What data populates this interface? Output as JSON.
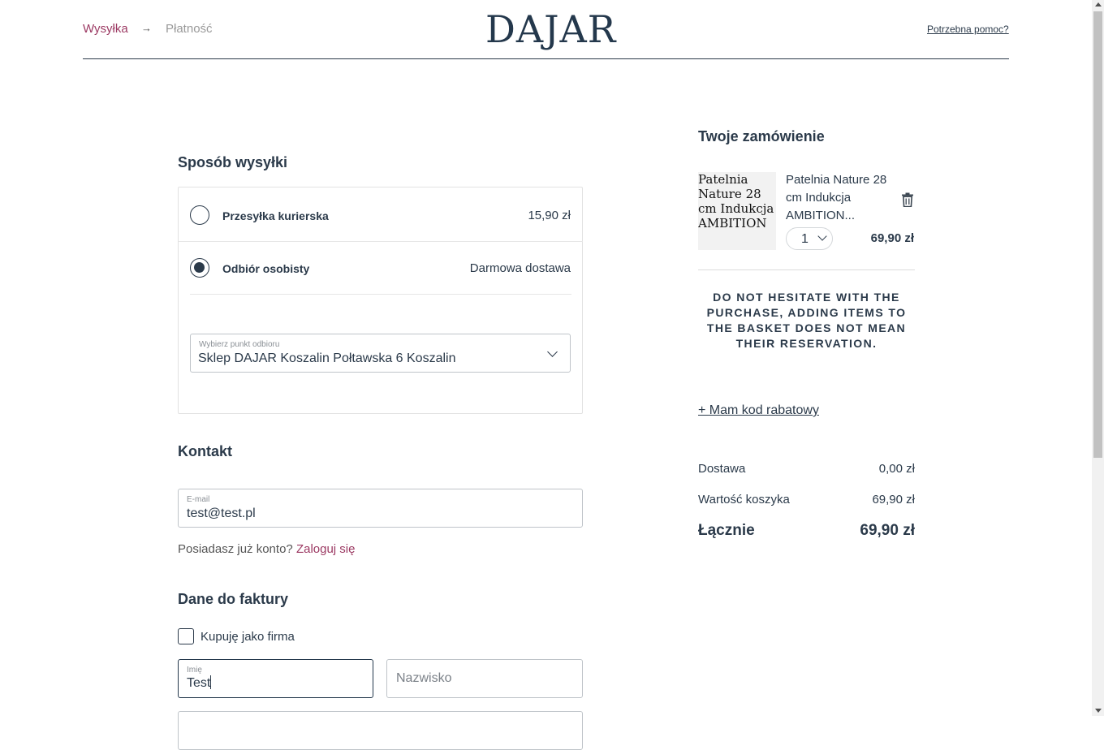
{
  "header": {
    "steps": [
      "Wysyłka",
      "Płatność"
    ],
    "logo": "DAJAR",
    "help": "Potrzebna pomoc?"
  },
  "shipping": {
    "title": "Sposób wysyłki",
    "options": [
      {
        "label": "Przesyłka kurierska",
        "price": "15,90 zł",
        "selected": false
      },
      {
        "label": "Odbiór osobisty",
        "price": "Darmowa dostawa",
        "selected": true
      }
    ],
    "pickup": {
      "label": "Wybierz punkt odbioru",
      "value": "Sklep DAJAR Koszalin Połtawska 6 Koszalin"
    }
  },
  "contact": {
    "title": "Kontakt",
    "email_label": "E-mail",
    "email_value": "test@test.pl",
    "account_question": "Posiadasz już konto?",
    "login_link": "Zaloguj się"
  },
  "invoice": {
    "title": "Dane do faktury",
    "company_checkbox": "Kupuję jako firma",
    "company_checked": false,
    "first_name_label": "Imię",
    "first_name_value": "Test",
    "last_name_placeholder": "Nazwisko"
  },
  "order": {
    "title": "Twoje zamówienie",
    "item": {
      "image_alt": "Patelnia Nature 28 cm Indukcja AMBITION",
      "name": "Patelnia Nature 28 cm Indukcja AMBITION...",
      "quantity": "1",
      "price": "69,90 zł"
    },
    "notice": "DO NOT HESITATE WITH THE PURCHASE, ADDING ITEMS TO THE BASKET DOES NOT MEAN THEIR RESERVATION.",
    "discount_link": "+ Mam kod rabatowy",
    "summary": [
      {
        "label": "Dostawa",
        "value": "0,00 zł"
      },
      {
        "label": "Wartość koszyka",
        "value": "69,90 zł"
      }
    ],
    "total": {
      "label": "Łącznie",
      "value": "69,90 zł"
    }
  },
  "colors": {
    "accent": "#9c3a63",
    "primary": "#2b3a4a",
    "logo": "#24384c"
  }
}
